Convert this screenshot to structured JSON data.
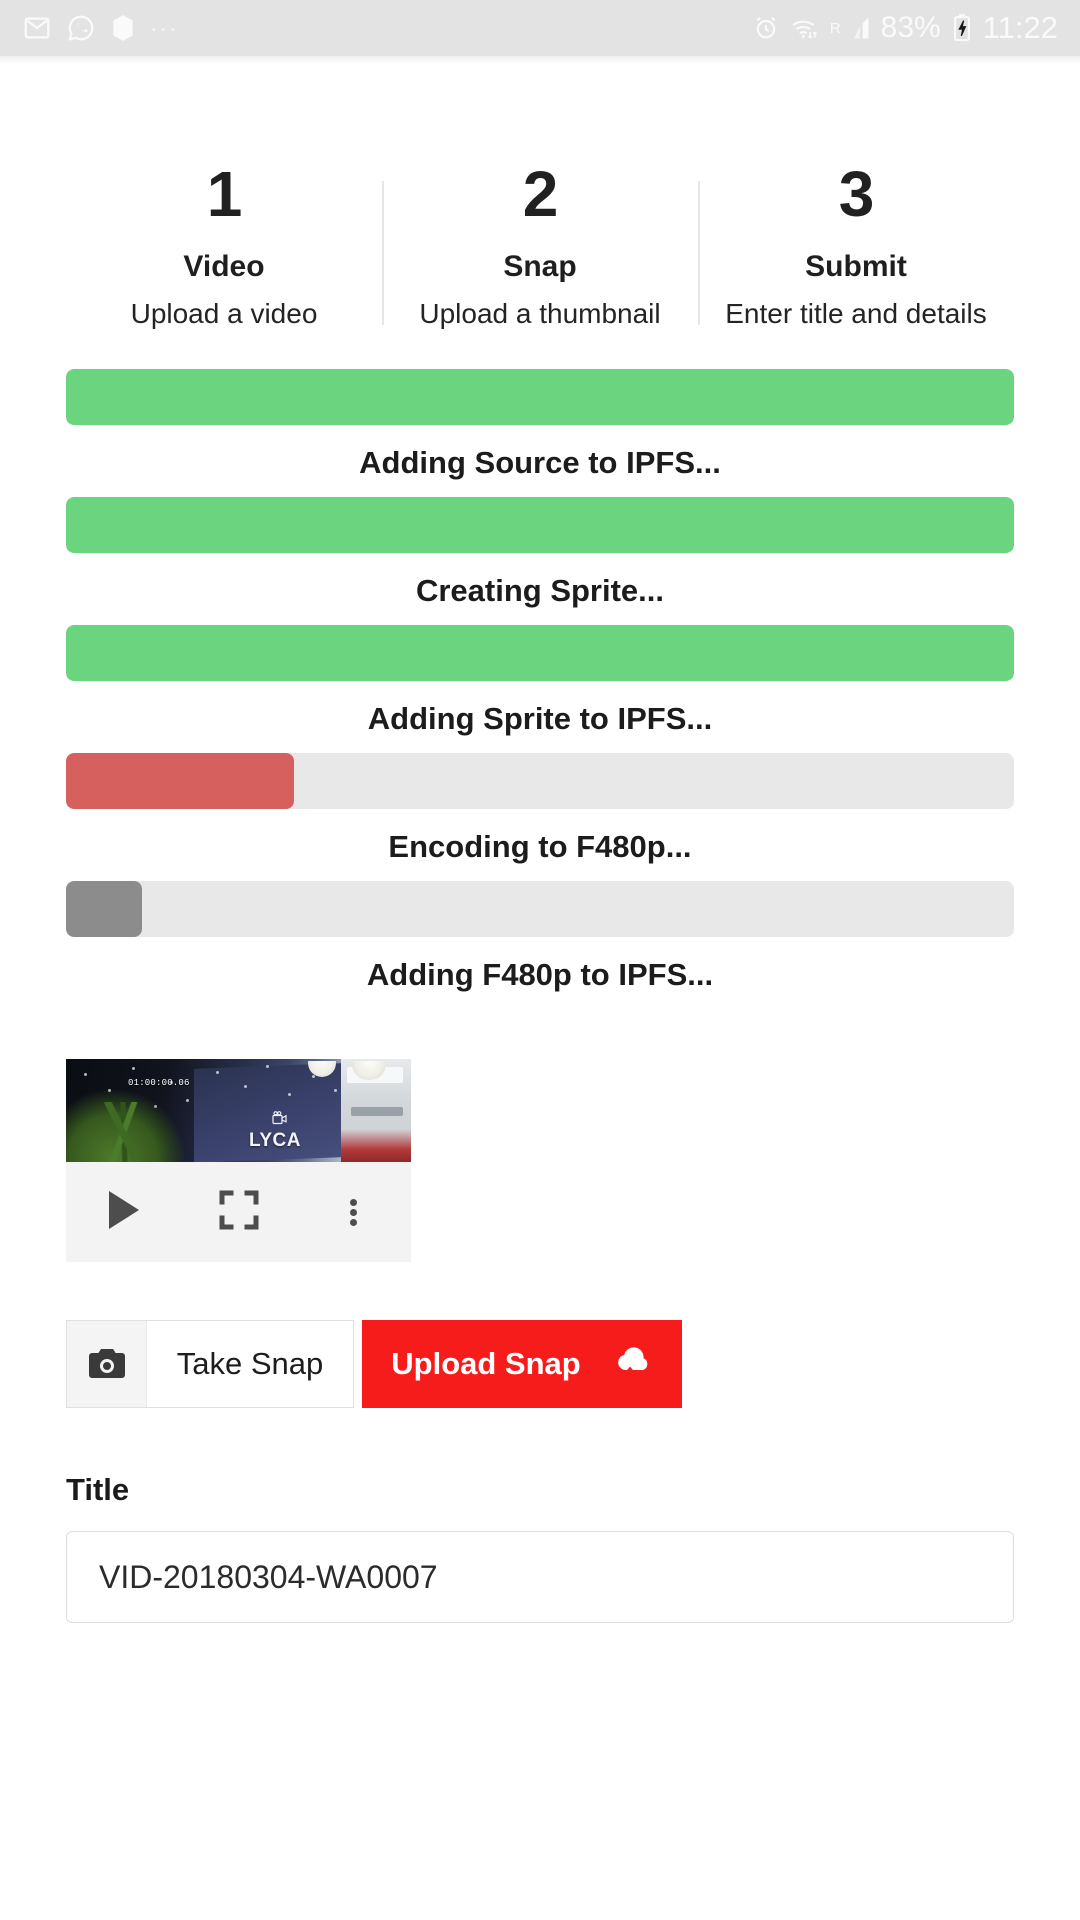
{
  "statusbar": {
    "left_icons": [
      "gmail-icon",
      "whatsapp-icon",
      "app-icon",
      "overflow-dots-icon"
    ],
    "overflow": "...",
    "roaming": "R",
    "battery_percent": "83%",
    "clock": "11:22",
    "right_icons": [
      "alarm-icon",
      "wifi-icon",
      "signal-icon",
      "battery-charging-icon"
    ]
  },
  "stepper": {
    "steps": [
      {
        "number": "1",
        "label": "Video",
        "desc": "Upload a video"
      },
      {
        "number": "2",
        "label": "Snap",
        "desc": "Upload a thumbnail"
      },
      {
        "number": "3",
        "label": "Submit",
        "desc": "Enter title and details"
      }
    ]
  },
  "progress": {
    "items": [
      {
        "caption": "Adding Source to IPFS...",
        "percent": 100,
        "color": "#6ad47f"
      },
      {
        "caption": "Creating Sprite...",
        "percent": 100,
        "color": "#6ad47f"
      },
      {
        "caption": "Adding Sprite to IPFS...",
        "percent": 100,
        "color": "#6ad47f"
      },
      {
        "caption": "Encoding to F480p...",
        "percent": 24,
        "color": "#d6605e"
      },
      {
        "caption": "Adding F480p to IPFS...",
        "percent": 8,
        "color": "#8c8c8c"
      }
    ]
  },
  "player": {
    "timecode": "01:00:00.06",
    "billboard_text": "LYCA",
    "controls": [
      "play-icon",
      "fullscreen-icon",
      "kebab-menu-icon"
    ]
  },
  "actions": {
    "take_snap_label": "Take Snap",
    "upload_snap_label": "Upload Snap",
    "upload_snap_color": "#f71c1c"
  },
  "title_field": {
    "label": "Title",
    "value": "VID-20180304-WA0007",
    "placeholder": "Title"
  }
}
